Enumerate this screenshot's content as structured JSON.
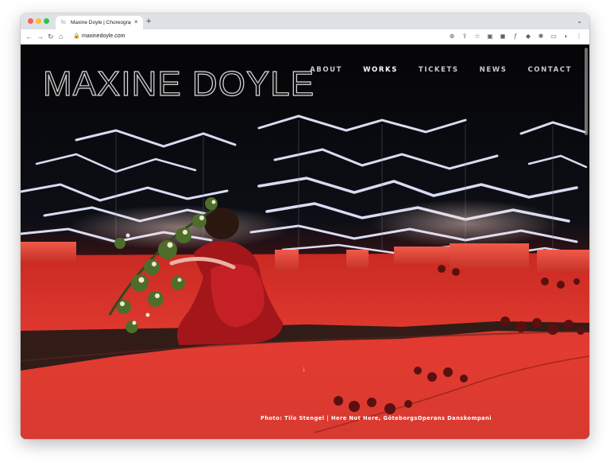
{
  "browser": {
    "tab_title": "Maxine Doyle | Choreographer",
    "tab_favicon": "fo",
    "tab_close": "×",
    "new_tab": "+",
    "tab_menu": "⌄",
    "url": "maxinedoyle.com",
    "nav_icons": {
      "back": "←",
      "forward": "→",
      "reload": "↻",
      "home": "⌂",
      "lock": "🔒"
    },
    "toolbar_icons": [
      "⊕",
      "⇪",
      "☆",
      "▣",
      "◼",
      "ƒ",
      "◆",
      "✱",
      "▭",
      "◐",
      "⋮"
    ]
  },
  "site": {
    "logo": "MAXINE DOYLE",
    "nav": [
      {
        "label": "ABOUT",
        "active": false
      },
      {
        "label": "WORKS",
        "active": true
      },
      {
        "label": "TICKETS",
        "active": false
      },
      {
        "label": "NEWS",
        "active": false
      },
      {
        "label": "CONTACT",
        "active": false
      }
    ],
    "scroll_hint": "↓",
    "caption": "Photo: Tilo Stengel | Here Not Here, GöteborgsOperans Danskompani"
  },
  "colors": {
    "stage_red": "#e23a30",
    "neon_white": "#dfe4ff",
    "background": "#0a0a0c"
  }
}
